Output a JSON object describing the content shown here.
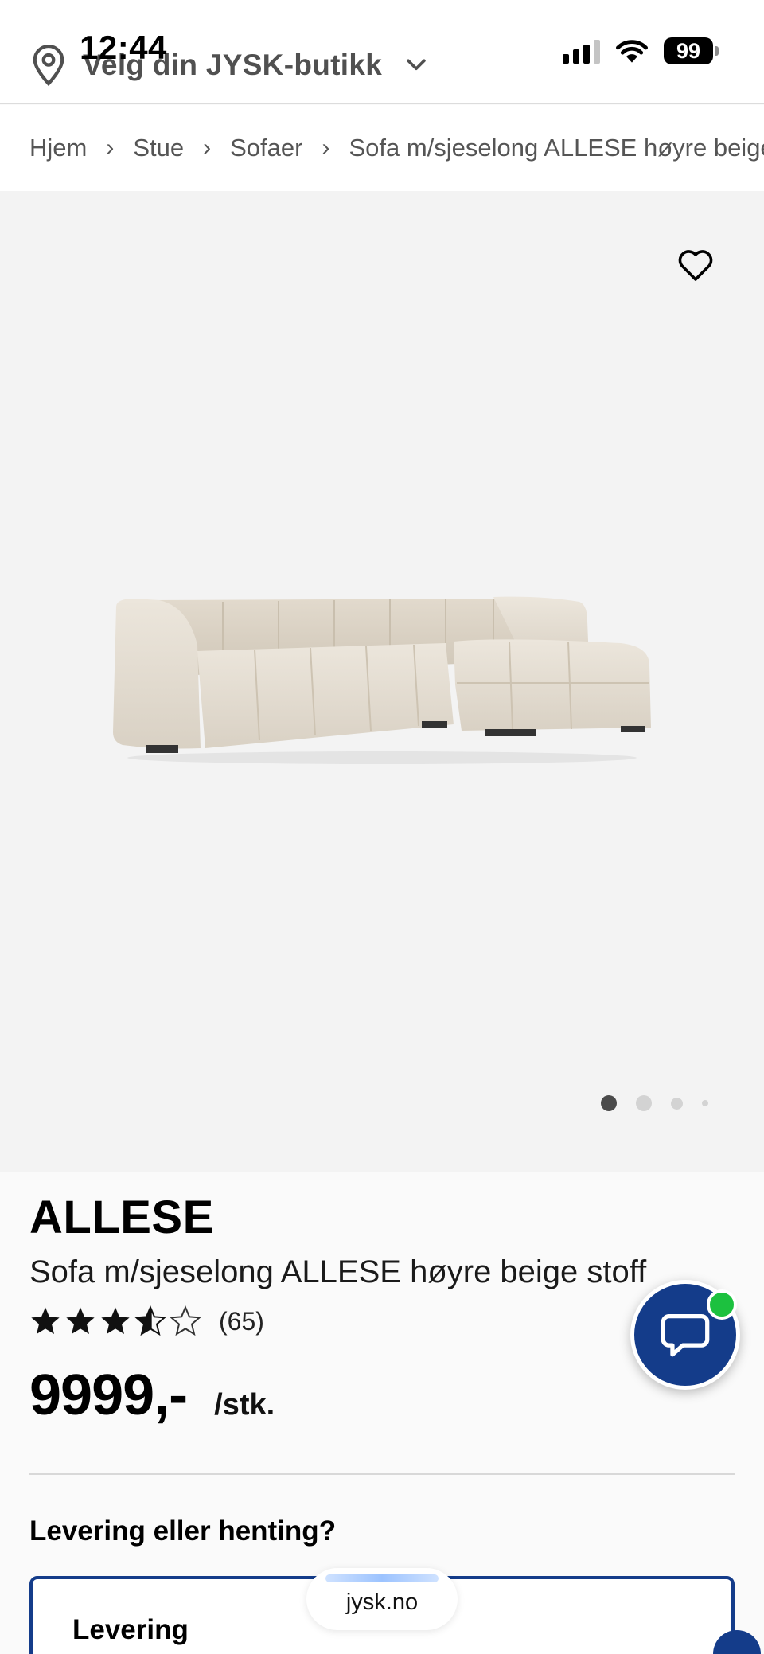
{
  "status_bar": {
    "time": "12:44",
    "battery": "99"
  },
  "header": {
    "store_picker_label": "Velg din JYSK-butikk"
  },
  "breadcrumb": [
    "Hjem",
    "Stue",
    "Sofaer",
    "Sofa m/sjeselong ALLESE høyre beige stoff"
  ],
  "gallery": {
    "image_count": 4,
    "active_index": 0,
    "favorite_icon": "heart-outline-icon"
  },
  "product": {
    "brand": "ALLESE",
    "name": "Sofa m/sjeselong ALLESE høyre beige stoff",
    "rating": 3.5,
    "rating_max": 5,
    "review_count": "(65)",
    "price": "9999,-",
    "price_unit": "/stk."
  },
  "delivery": {
    "question": "Levering eller henting?",
    "option_label": "Levering"
  },
  "browser": {
    "url": "jysk.no"
  },
  "colors": {
    "brand_blue": "#143c8a",
    "online_green": "#1cc13f",
    "gallery_bg": "#f3f3f3"
  }
}
